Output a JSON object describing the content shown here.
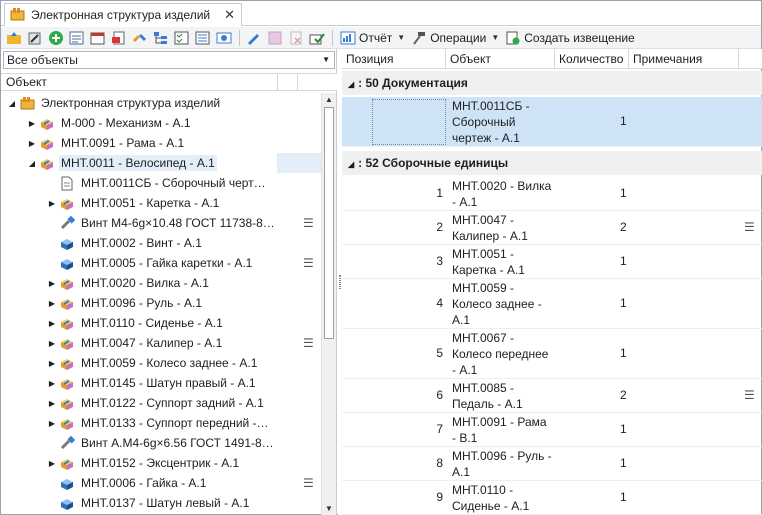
{
  "tab": {
    "title": "Электронная структура изделий",
    "close": "✕"
  },
  "toolbar": {
    "report": "Отчёт",
    "operations": "Операции",
    "create_notice": "Создать извещение"
  },
  "left": {
    "filter": "Все объекты",
    "header": "Объект",
    "tree": [
      {
        "level": 0,
        "exp": "◢",
        "icon": "structure",
        "label": "Электронная структура изделий"
      },
      {
        "level": 1,
        "exp": "▶",
        "icon": "assembly",
        "label": "М-000 - Механизм - А.1"
      },
      {
        "level": 1,
        "exp": "▶",
        "icon": "assembly",
        "label": "МНТ.0091 - Рама - А.1"
      },
      {
        "level": 1,
        "exp": "◢",
        "icon": "assembly",
        "label": "МНТ.0011 - Велосипед - А.1",
        "selected": true
      },
      {
        "level": 2,
        "exp": "",
        "icon": "document",
        "label": "МНТ.0011СБ - Сборочный черт…"
      },
      {
        "level": 2,
        "exp": "▶",
        "icon": "assembly",
        "label": "МНТ.0051 - Каретка - А.1"
      },
      {
        "level": 2,
        "exp": "",
        "icon": "standard",
        "label": "Винт М4-6g×10.48 ГОСТ 11738-8…",
        "menu": true
      },
      {
        "level": 2,
        "exp": "",
        "icon": "part",
        "label": "МНТ.0002 - Винт - А.1"
      },
      {
        "level": 2,
        "exp": "",
        "icon": "part",
        "label": "МНТ.0005 - Гайка каретки - А.1",
        "menu": true
      },
      {
        "level": 2,
        "exp": "▶",
        "icon": "assembly",
        "label": "МНТ.0020 - Вилка - А.1"
      },
      {
        "level": 2,
        "exp": "▶",
        "icon": "assembly",
        "label": "МНТ.0096 - Руль - А.1"
      },
      {
        "level": 2,
        "exp": "▶",
        "icon": "assembly",
        "label": "МНТ.0110 - Сиденье - А.1"
      },
      {
        "level": 2,
        "exp": "▶",
        "icon": "assembly",
        "label": "МНТ.0047 - Калипер - А.1",
        "menu": true
      },
      {
        "level": 2,
        "exp": "▶",
        "icon": "assembly",
        "label": "МНТ.0059 - Колесо заднее - А.1"
      },
      {
        "level": 2,
        "exp": "▶",
        "icon": "assembly",
        "label": "МНТ.0145 - Шатун правый - А.1"
      },
      {
        "level": 2,
        "exp": "▶",
        "icon": "assembly",
        "label": "МНТ.0122 - Суппорт задний - А.1"
      },
      {
        "level": 2,
        "exp": "▶",
        "icon": "assembly",
        "label": "МНТ.0133 - Суппорт передний -…"
      },
      {
        "level": 2,
        "exp": "",
        "icon": "standard",
        "label": "Винт А.М4-6g×6.56 ГОСТ 1491-8…"
      },
      {
        "level": 2,
        "exp": "▶",
        "icon": "assembly",
        "label": "МНТ.0152 - Эксцентрик - А.1"
      },
      {
        "level": 2,
        "exp": "",
        "icon": "part",
        "label": "МНТ.0006 - Гайка - А.1",
        "menu": true
      },
      {
        "level": 2,
        "exp": "",
        "icon": "part",
        "label": "МНТ.0137 - Шатун левый - А.1"
      }
    ]
  },
  "right": {
    "columns": [
      "Позиция",
      "Объект",
      "Количество",
      "Примечания"
    ],
    "groups": [
      {
        "title": ": 50 Документация",
        "rows": [
          {
            "pos": "",
            "obj": [
              "МНТ.0011СБ -",
              "Сборочный",
              "чертеж - А.1"
            ],
            "qty": "1",
            "selected": true
          }
        ]
      },
      {
        "title": ": 52 Сборочные единицы",
        "rows": [
          {
            "pos": "1",
            "obj": [
              "МНТ.0020 - Вилка",
              "- А.1"
            ],
            "qty": "1"
          },
          {
            "pos": "2",
            "obj": [
              "МНТ.0047 -",
              "Калипер - А.1"
            ],
            "qty": "2",
            "menu": true
          },
          {
            "pos": "3",
            "obj": [
              "МНТ.0051 -",
              "Каретка - А.1"
            ],
            "qty": "1"
          },
          {
            "pos": "4",
            "obj": [
              "МНТ.0059 -",
              "Колесо заднее -",
              "А.1"
            ],
            "qty": "1"
          },
          {
            "pos": "5",
            "obj": [
              "МНТ.0067 -",
              "Колесо переднее",
              "- А.1"
            ],
            "qty": "1"
          },
          {
            "pos": "6",
            "obj": [
              "МНТ.0085 -",
              "Педаль - А.1"
            ],
            "qty": "2",
            "menu": true
          },
          {
            "pos": "7",
            "obj": [
              "МНТ.0091 - Рама",
              "- В.1"
            ],
            "qty": "1"
          },
          {
            "pos": "8",
            "obj": [
              "МНТ.0096 - Руль -",
              "А.1"
            ],
            "qty": "1"
          },
          {
            "pos": "9",
            "obj": [
              "МНТ.0110 -",
              "Сиденье - А.1"
            ],
            "qty": "1"
          }
        ]
      }
    ]
  }
}
